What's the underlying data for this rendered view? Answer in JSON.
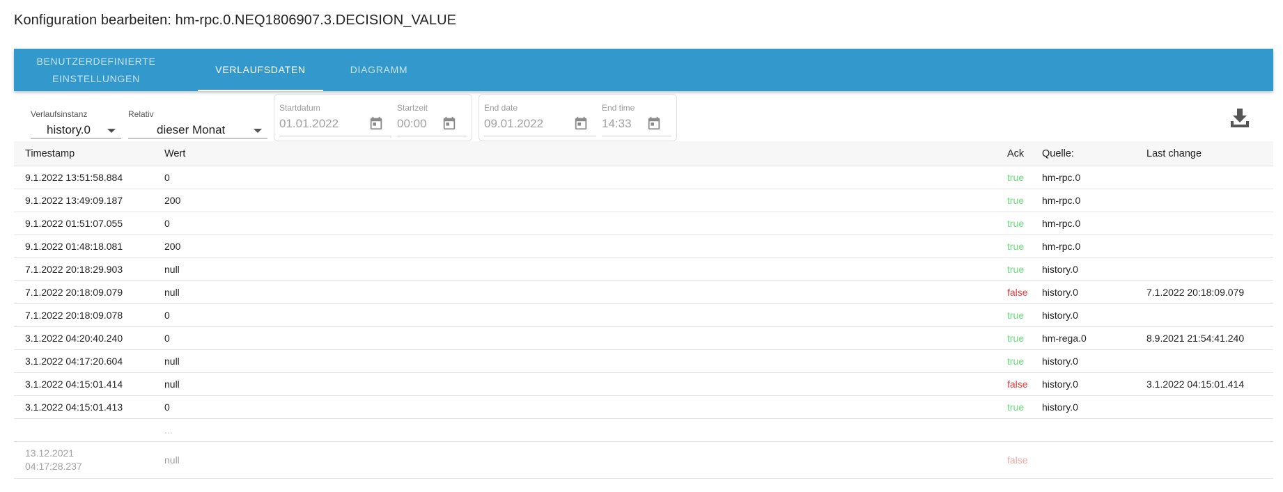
{
  "title": "Konfiguration bearbeiten: hm-rpc.0.NEQ1806907.3.DECISION_VALUE",
  "tabs": [
    {
      "label": "BENUTZERDEFINIERTE EINSTELLUNGEN",
      "line1": "BENUTZERDEFINIERTE",
      "line2": "EINSTELLUNGEN",
      "active": false
    },
    {
      "label": "VERLAUFSDATEN",
      "active": true
    },
    {
      "label": "DIAGRAMM",
      "active": false
    }
  ],
  "controls": {
    "instance": {
      "label": "Verlaufsinstanz",
      "value": "history.0"
    },
    "relative": {
      "label": "Relativ",
      "value": "dieser Monat"
    },
    "start_date": {
      "label": "Startdatum",
      "value": "01.01.2022"
    },
    "start_time": {
      "label": "Startzeit",
      "value": "00:00"
    },
    "end_date": {
      "label": "End date",
      "value": "09.01.2022"
    },
    "end_time": {
      "label": "End time",
      "value": "14:33"
    }
  },
  "icons": {
    "calendar": "calendar-icon",
    "download": "download-icon",
    "dropdown": "chevron-down-icon"
  },
  "colors": {
    "header": "#3399cc",
    "ack_true": "#66dd77",
    "ack_false": "#e83a3a"
  },
  "table": {
    "columns": [
      "Timestamp",
      "Wert",
      "Ack",
      "Quelle:",
      "Last change"
    ],
    "rows": [
      {
        "ts": "9.1.2022 13:51:58.884",
        "val": "0",
        "ack": "true",
        "src": "hm-rpc.0",
        "lc": ""
      },
      {
        "ts": "9.1.2022 13:49:09.187",
        "val": "200",
        "ack": "true",
        "src": "hm-rpc.0",
        "lc": ""
      },
      {
        "ts": "9.1.2022 01:51:07.055",
        "val": "0",
        "ack": "true",
        "src": "hm-rpc.0",
        "lc": ""
      },
      {
        "ts": "9.1.2022 01:48:18.081",
        "val": "200",
        "ack": "true",
        "src": "hm-rpc.0",
        "lc": ""
      },
      {
        "ts": "7.1.2022 20:18:29.903",
        "val": "null",
        "ack": "true",
        "src": "history.0",
        "lc": ""
      },
      {
        "ts": "7.1.2022 20:18:09.079",
        "val": "null",
        "ack": "false",
        "src": "history.0",
        "lc": "7.1.2022 20:18:09.079"
      },
      {
        "ts": "7.1.2022 20:18:09.078",
        "val": "0",
        "ack": "true",
        "src": "history.0",
        "lc": ""
      },
      {
        "ts": "3.1.2022 04:20:40.240",
        "val": "0",
        "ack": "true",
        "src": "hm-rega.0",
        "lc": "8.9.2021 21:54:41.240"
      },
      {
        "ts": "3.1.2022 04:17:20.604",
        "val": "null",
        "ack": "true",
        "src": "history.0",
        "lc": ""
      },
      {
        "ts": "3.1.2022 04:15:01.414",
        "val": "null",
        "ack": "false",
        "src": "history.0",
        "lc": "3.1.2022 04:15:01.414"
      },
      {
        "ts": "3.1.2022 04:15:01.413",
        "val": "0",
        "ack": "true",
        "src": "history.0",
        "lc": ""
      }
    ],
    "gap": "...",
    "earlier": {
      "ts_date": "13.12.2021",
      "ts_time": "04:17:28.237",
      "val": "null",
      "ack": "false"
    }
  }
}
